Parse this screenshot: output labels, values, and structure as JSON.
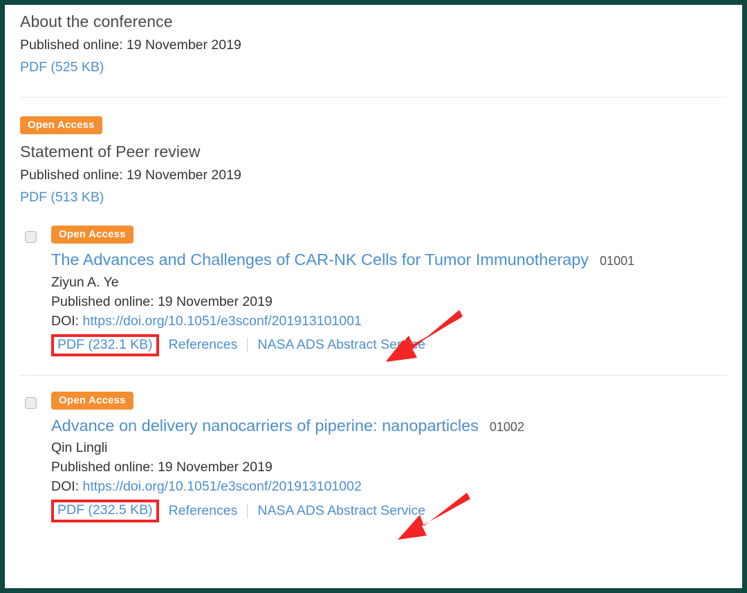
{
  "page": {
    "frame_color": "#0f4741",
    "background": "#ffffff",
    "link_color": "#4b8fd0",
    "badge_color": "#f48f31",
    "annotation_color": "#f42525"
  },
  "entries": [
    {
      "kind": "simple",
      "title": "About the conference",
      "published": "Published online: 19 November 2019",
      "pdf_label": "PDF (525 KB)",
      "badge": null
    },
    {
      "kind": "simple",
      "title": "Statement of Peer review",
      "published": "Published online: 19 November 2019",
      "pdf_label": "PDF (513 KB)",
      "badge": "Open Access"
    }
  ],
  "articles": [
    {
      "badge": "Open Access",
      "title": "The Advances and Challenges of CAR-NK Cells for Tumor Immunotherapy",
      "number": "01001",
      "authors": "Ziyun A. Ye",
      "published": "Published online: 19 November 2019",
      "doi_prefix": "DOI: ",
      "doi_url": "https://doi.org/10.1051/e3sconf/201913101001",
      "pdf_label": "PDF (232.1 KB)",
      "references_label": "References",
      "nasa_label": "NASA ADS Abstract Service"
    },
    {
      "badge": "Open Access",
      "title": "Advance on delivery nanocarriers of piperine: nanoparticles",
      "number": "01002",
      "authors": "Qin Lingli",
      "published": "Published online: 19 November 2019",
      "doi_prefix": "DOI: ",
      "doi_url": "https://doi.org/10.1051/e3sconf/201913101002",
      "pdf_label": "PDF (232.5 KB)",
      "references_label": "References",
      "nasa_label": "NASA ADS Abstract Service"
    }
  ]
}
